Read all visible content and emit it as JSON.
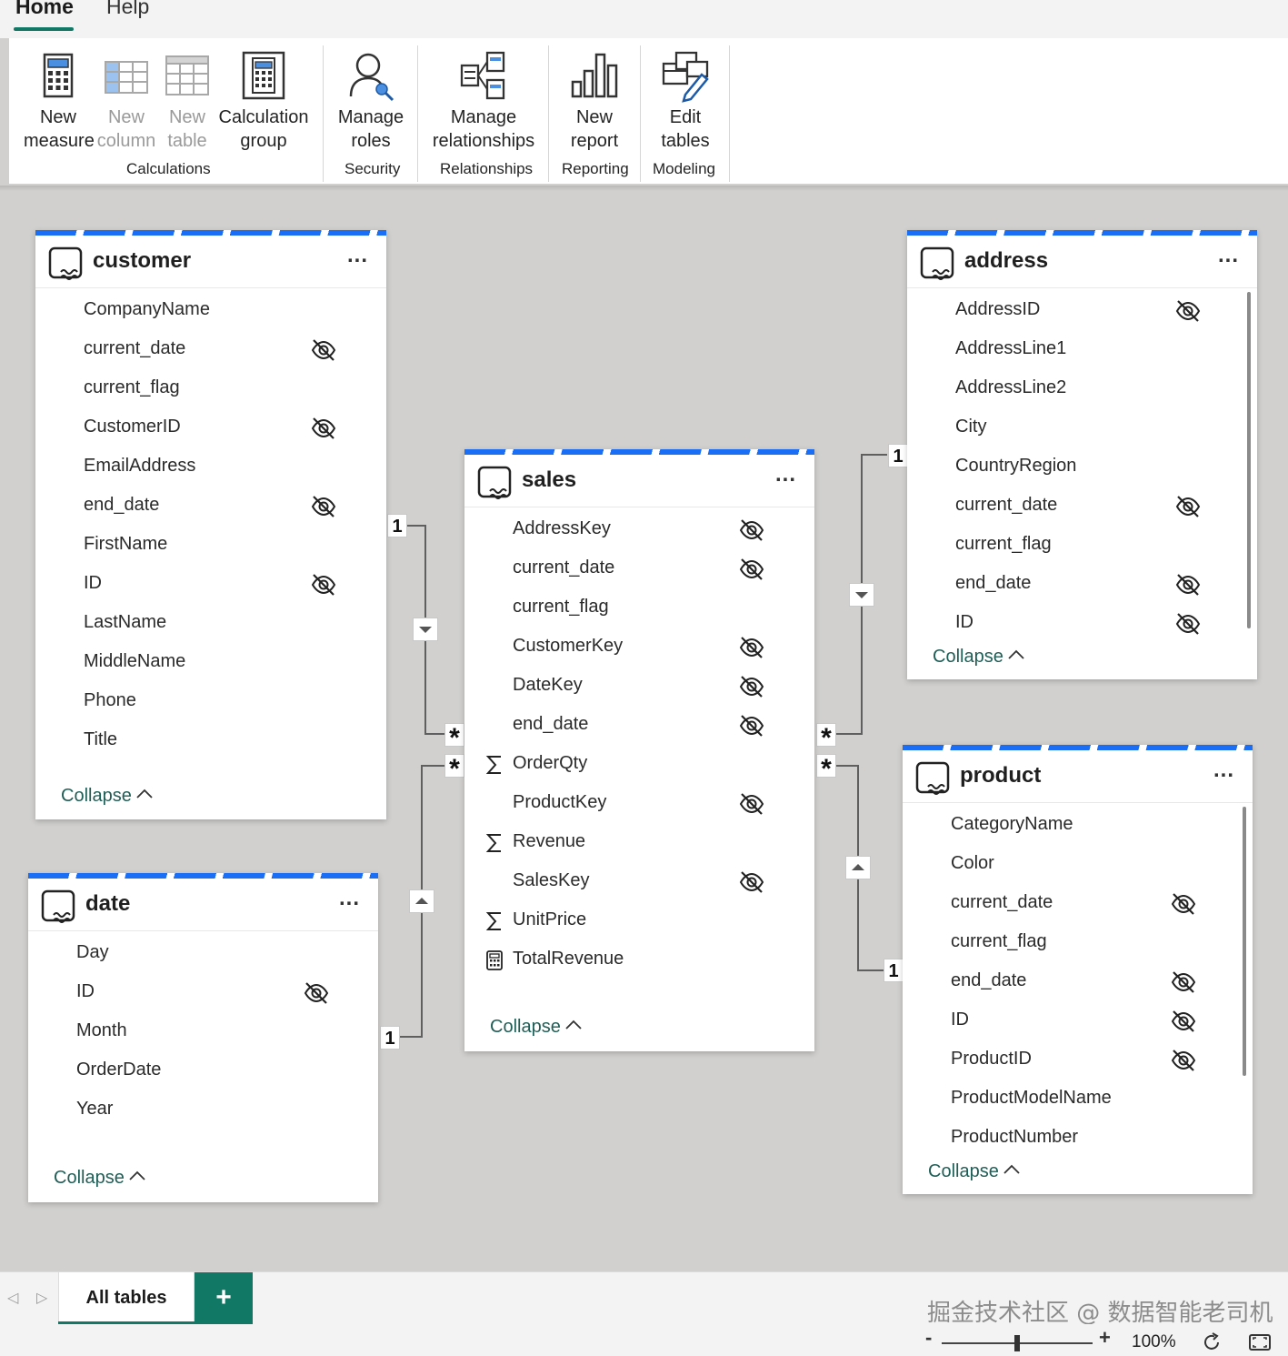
{
  "menu": {
    "home": "Home",
    "help": "Help"
  },
  "ribbon": {
    "new_measure": [
      "New",
      "measure"
    ],
    "new_column": [
      "New",
      "column"
    ],
    "new_table": [
      "New",
      "table"
    ],
    "calculation_group": [
      "Calculation",
      "group"
    ],
    "manage_roles": [
      "Manage",
      "roles"
    ],
    "manage_relationships": [
      "Manage",
      "relationships"
    ],
    "new_report": [
      "New",
      "report"
    ],
    "edit_tables": [
      "Edit",
      "tables"
    ],
    "groups": {
      "calculations": "Calculations",
      "security": "Security",
      "relationships": "Relationships",
      "reporting": "Reporting",
      "modeling": "Modeling"
    }
  },
  "tables": {
    "customer": {
      "title": "customer",
      "more": "...",
      "collapse": "Collapse",
      "fields": [
        {
          "name": "CompanyName",
          "hidden": false
        },
        {
          "name": "current_date",
          "hidden": true
        },
        {
          "name": "current_flag",
          "hidden": false
        },
        {
          "name": "CustomerID",
          "hidden": true
        },
        {
          "name": "EmailAddress",
          "hidden": false
        },
        {
          "name": "end_date",
          "hidden": true
        },
        {
          "name": "FirstName",
          "hidden": false
        },
        {
          "name": "ID",
          "hidden": true
        },
        {
          "name": "LastName",
          "hidden": false
        },
        {
          "name": "MiddleName",
          "hidden": false
        },
        {
          "name": "Phone",
          "hidden": false
        },
        {
          "name": "Title",
          "hidden": false
        }
      ]
    },
    "date": {
      "title": "date",
      "more": "...",
      "collapse": "Collapse",
      "fields": [
        {
          "name": "Day",
          "hidden": false
        },
        {
          "name": "ID",
          "hidden": true
        },
        {
          "name": "Month",
          "hidden": false
        },
        {
          "name": "OrderDate",
          "hidden": false
        },
        {
          "name": "Year",
          "hidden": false
        }
      ]
    },
    "sales": {
      "title": "sales",
      "more": "...",
      "collapse": "Collapse",
      "fields": [
        {
          "name": "AddressKey",
          "hidden": true,
          "icon": ""
        },
        {
          "name": "current_date",
          "hidden": true,
          "icon": ""
        },
        {
          "name": "current_flag",
          "hidden": false,
          "icon": ""
        },
        {
          "name": "CustomerKey",
          "hidden": true,
          "icon": ""
        },
        {
          "name": "DateKey",
          "hidden": true,
          "icon": ""
        },
        {
          "name": "end_date",
          "hidden": true,
          "icon": ""
        },
        {
          "name": "OrderQty",
          "hidden": false,
          "icon": "sigma-icon"
        },
        {
          "name": "ProductKey",
          "hidden": true,
          "icon": ""
        },
        {
          "name": "Revenue",
          "hidden": false,
          "icon": "sigma-icon"
        },
        {
          "name": "SalesKey",
          "hidden": true,
          "icon": ""
        },
        {
          "name": "UnitPrice",
          "hidden": false,
          "icon": "sigma-icon"
        },
        {
          "name": "TotalRevenue",
          "hidden": false,
          "icon": "calculator-icon"
        }
      ]
    },
    "address": {
      "title": "address",
      "more": "...",
      "collapse": "Collapse",
      "fields": [
        {
          "name": "AddressID",
          "hidden": true
        },
        {
          "name": "AddressLine1",
          "hidden": false
        },
        {
          "name": "AddressLine2",
          "hidden": false
        },
        {
          "name": "City",
          "hidden": false
        },
        {
          "name": "CountryRegion",
          "hidden": false
        },
        {
          "name": "current_date",
          "hidden": true
        },
        {
          "name": "current_flag",
          "hidden": false
        },
        {
          "name": "end_date",
          "hidden": true
        },
        {
          "name": "ID",
          "hidden": true
        }
      ]
    },
    "product": {
      "title": "product",
      "more": "...",
      "collapse": "Collapse",
      "fields": [
        {
          "name": "CategoryName",
          "hidden": false
        },
        {
          "name": "Color",
          "hidden": false
        },
        {
          "name": "current_date",
          "hidden": true
        },
        {
          "name": "current_flag",
          "hidden": false
        },
        {
          "name": "end_date",
          "hidden": true
        },
        {
          "name": "ID",
          "hidden": true
        },
        {
          "name": "ProductID",
          "hidden": true
        },
        {
          "name": "ProductModelName",
          "hidden": false
        },
        {
          "name": "ProductNumber",
          "hidden": false
        }
      ]
    }
  },
  "relationships": {
    "one": "1",
    "many": "*"
  },
  "bottom": {
    "tab_all": "All tables",
    "add_tab": "+",
    "watermark": "掘金技术社区 @ 数据智能老司机"
  },
  "status": {
    "zoom_minus": "-",
    "zoom_plus": "+",
    "zoom_level": "100%",
    "zoom_fraction": 0.5
  },
  "colors": {
    "accent": "#117865",
    "table_stripe": "#1a6ef5",
    "canvas": "#d1d0ce"
  }
}
